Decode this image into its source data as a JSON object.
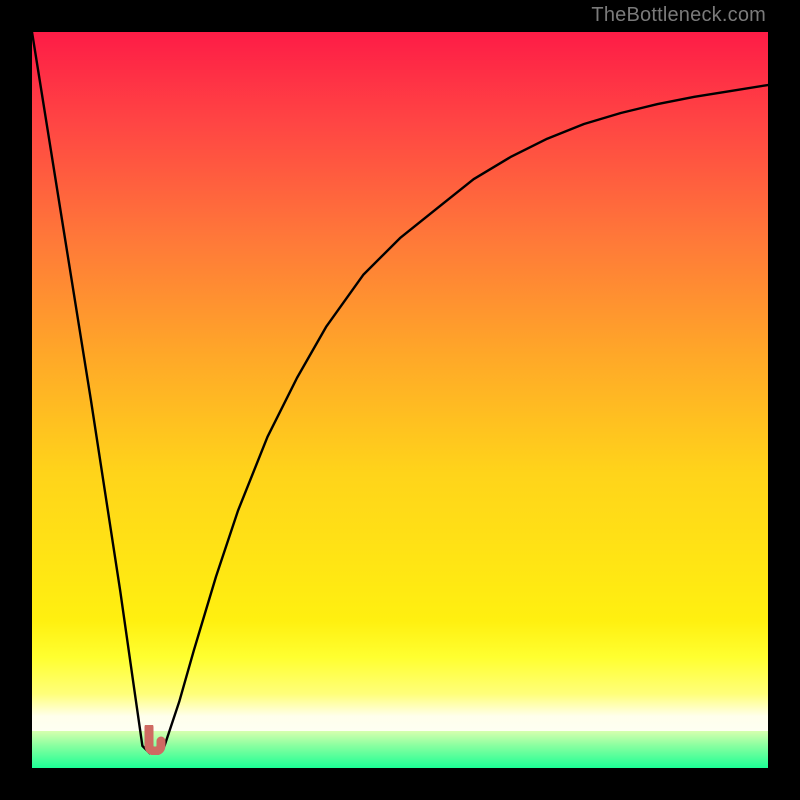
{
  "watermark": "TheBottleneck.com",
  "colors": {
    "frame": "#000000",
    "gradient_top": "#fe1c46",
    "gradient_mid": "#ffd41a",
    "gradient_low": "#ffff7a",
    "gradient_green": "#1cff95",
    "curve": "#000000",
    "marker": "#cf6a62"
  },
  "chart_data": {
    "type": "line",
    "title": "",
    "xlabel": "",
    "ylabel": "",
    "xlim": [
      0,
      100
    ],
    "ylim": [
      0,
      100
    ],
    "series": [
      {
        "name": "bottleneck-curve",
        "x": [
          0,
          4,
          8,
          12,
          14,
          15,
          16,
          17,
          18,
          20,
          22,
          25,
          28,
          32,
          36,
          40,
          45,
          50,
          55,
          60,
          65,
          70,
          75,
          80,
          85,
          90,
          95,
          100
        ],
        "values": [
          100,
          75,
          50,
          24,
          10,
          3,
          2,
          2,
          3,
          9,
          16,
          26,
          35,
          45,
          53,
          60,
          67,
          72,
          76,
          80,
          83,
          85.5,
          87.5,
          89,
          90.2,
          91.2,
          92,
          92.8
        ]
      }
    ],
    "marker": {
      "x": 16.5,
      "y": 2,
      "shape": "J",
      "label": "optimum-marker"
    },
    "annotations": []
  }
}
